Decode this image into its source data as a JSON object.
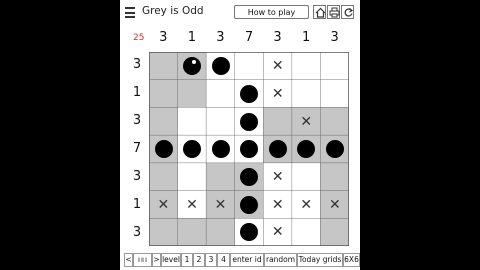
{
  "header": {
    "title": "Grey is Odd",
    "howto_label": "How to play"
  },
  "puzzle": {
    "count": "25",
    "col_clues": [
      "3",
      "1",
      "3",
      "7",
      "3",
      "1",
      "3"
    ],
    "row_clues": [
      "3",
      "1",
      "3",
      "7",
      "3",
      "1",
      "3"
    ]
  },
  "footer": {
    "prev": "<",
    "scroll": "|||||||",
    "next": ">",
    "level": "level",
    "l1": "1",
    "l2": "2",
    "l3": "3",
    "l4": "4",
    "enter_id": "enter id",
    "random": "random",
    "today": "Today grids",
    "size": "6X6"
  }
}
